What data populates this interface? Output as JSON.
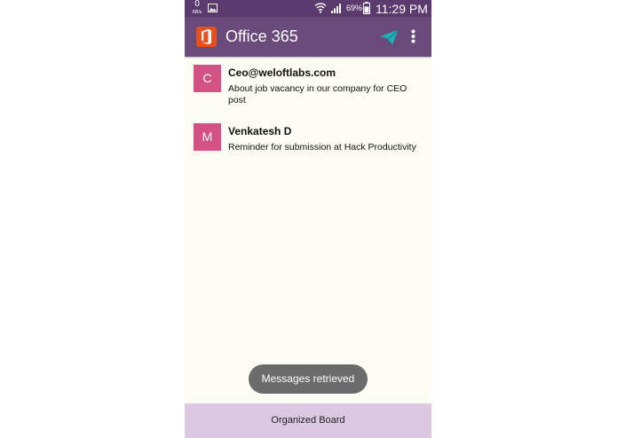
{
  "status_bar": {
    "net_speed_value": "0",
    "net_speed_unit": "KB/s",
    "battery_percent": "69%",
    "time": "11:29 PM"
  },
  "app_bar": {
    "title": "Office 365",
    "icons": [
      "office-logo",
      "send-icon",
      "more-vert-icon"
    ]
  },
  "messages": [
    {
      "avatar_letter": "C",
      "sender": "Ceo@weloftlabs.com",
      "snippet": "About job vacancy in our company for CEO post"
    },
    {
      "avatar_letter": "M",
      "sender": "Venkatesh D",
      "snippet": "Reminder for submission at Hack Productivity"
    }
  ],
  "toast": {
    "text": "Messages retrieved"
  },
  "bottom_bar": {
    "label": "Organized Board"
  },
  "colors": {
    "status_bar": "#5b3b6e",
    "app_bar": "#6a497b",
    "avatar": "#d45283",
    "send_icon": "#1eb0b8",
    "board": "#dcc8e1",
    "office_logo": "#e6501a"
  }
}
